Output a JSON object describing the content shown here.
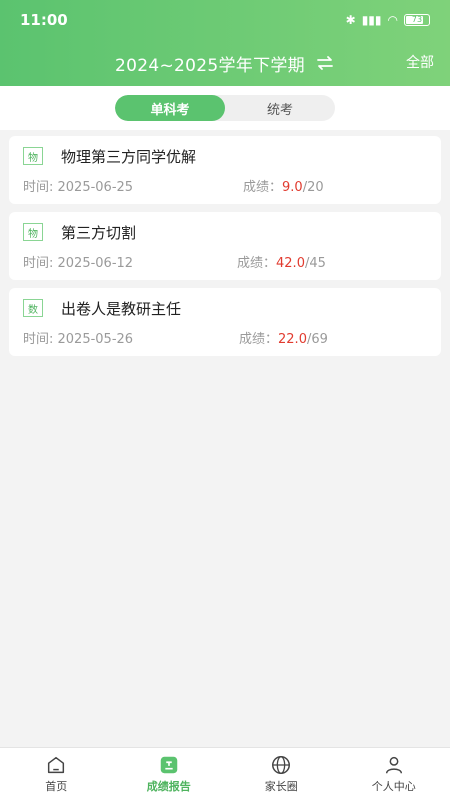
{
  "status_bar": {
    "time": "11:00",
    "battery": "73"
  },
  "header": {
    "term": "2024~2025学年下学期",
    "filter": "全部"
  },
  "tabs": [
    {
      "label": "单科考",
      "active": true
    },
    {
      "label": "统考",
      "active": false
    }
  ],
  "exams": [
    {
      "subject": "物",
      "name": "物理第三方同学优解",
      "time_label": "时间: ",
      "time": "2025-06-25",
      "score_label": "成绩：",
      "score": "9.0",
      "total": "/20"
    },
    {
      "subject": "物",
      "name": "第三方切割",
      "time_label": "时间: ",
      "time": "2025-06-12",
      "score_label": "成绩：",
      "score": "42.0",
      "total": "/45"
    },
    {
      "subject": "数",
      "name": "出卷人是教研主任",
      "time_label": "时间: ",
      "time": "2025-05-26",
      "score_label": "成绩：",
      "score": "22.0",
      "total": "/69"
    }
  ],
  "bottom_nav": [
    {
      "label": "首页",
      "icon": "home-icon"
    },
    {
      "label": "成绩报告",
      "icon": "report-icon",
      "active": true
    },
    {
      "label": "家长圈",
      "icon": "globe-icon"
    },
    {
      "label": "个人中心",
      "icon": "person-icon"
    }
  ],
  "colors": {
    "accent": "#5bc36f",
    "score": "#e13b2f"
  }
}
